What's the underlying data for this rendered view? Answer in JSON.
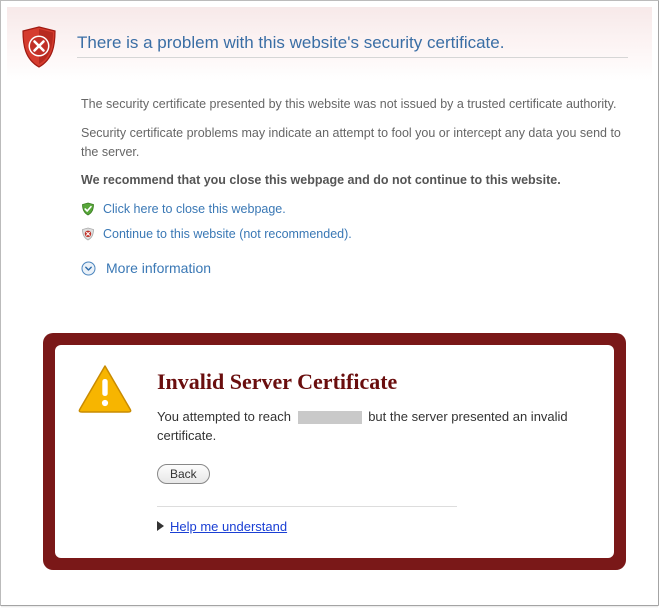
{
  "ie": {
    "title": "There is a problem with this website's security certificate.",
    "p1": "The security certificate presented by this website was not issued by a trusted certificate authority.",
    "p2": "Security certificate problems may indicate an attempt to fool you or intercept any data you send to the server.",
    "p3": "We recommend that you close this webpage and do not continue to this website.",
    "close_label": "Click here to close this webpage.",
    "continue_label": "Continue to this website (not recommended).",
    "more_label": "More information"
  },
  "chrome": {
    "title": "Invalid Server Certificate",
    "msg_prefix": "You attempted to reach",
    "msg_suffix": "but the server presented an invalid certificate.",
    "back_label": "Back",
    "help_label": "Help me understand"
  }
}
